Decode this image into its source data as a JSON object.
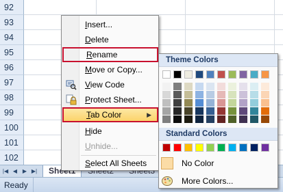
{
  "rows": [
    "92",
    "93",
    "94",
    "95",
    "96",
    "97",
    "98",
    "99",
    "100",
    "101",
    "102"
  ],
  "sheet_tabs": [
    "Sheet1",
    "Sheet2",
    "Sheet3"
  ],
  "status": {
    "text": "Ready"
  },
  "context_menu": {
    "items": [
      {
        "label": "Insert...",
        "underline": "I"
      },
      {
        "label": "Delete",
        "underline": "D"
      },
      {
        "label": "Rename",
        "underline": "R"
      },
      {
        "label": "Move or Copy...",
        "underline": "M"
      },
      {
        "label": "View Code",
        "underline": "V"
      },
      {
        "label": "Protect Sheet...",
        "underline": "P"
      },
      {
        "label": "Tab Color",
        "underline": "T"
      },
      {
        "label": "Hide",
        "underline": "H"
      },
      {
        "label": "Unhide...",
        "underline": "U"
      },
      {
        "label": "Select All Sheets",
        "underline": "S"
      }
    ]
  },
  "tab_color_menu": {
    "theme_colors_label": "Theme Colors",
    "standard_colors_label": "Standard Colors",
    "no_color_label": "No Color",
    "more_colors_label": "More Colors...",
    "theme_base": [
      "#ffffff",
      "#000000",
      "#eeece1",
      "#1f497d",
      "#4f81bd",
      "#c0504d",
      "#9bbb59",
      "#8064a2",
      "#4bacc6",
      "#f79646"
    ],
    "theme_shades": [
      [
        "#f2f2f2",
        "#7f7f7f",
        "#ddd9c3",
        "#c6d9f0",
        "#dbe5f1",
        "#f2dcdb",
        "#ebf1dd",
        "#e5e0ec",
        "#dbeef3",
        "#fdeada"
      ],
      [
        "#d8d8d8",
        "#595959",
        "#c4bd97",
        "#8db3e2",
        "#b8cce4",
        "#e5b9b7",
        "#d7e3bc",
        "#ccc1d9",
        "#b7dde8",
        "#fbd5b5"
      ],
      [
        "#bfbfbf",
        "#3f3f3f",
        "#938953",
        "#548dd4",
        "#95b3d7",
        "#d99694",
        "#c3d69b",
        "#b2a2c7",
        "#92cddc",
        "#fac08f"
      ],
      [
        "#a5a5a5",
        "#262626",
        "#494429",
        "#17365d",
        "#366092",
        "#953734",
        "#76923c",
        "#5f497a",
        "#31859b",
        "#e36c09"
      ],
      [
        "#7f7f7f",
        "#0c0c0c",
        "#1d1b10",
        "#0f243e",
        "#244061",
        "#632423",
        "#4f6128",
        "#3f3151",
        "#205867",
        "#974806"
      ]
    ],
    "standard": [
      "#c00000",
      "#ff0000",
      "#ffc000",
      "#ffff00",
      "#92d050",
      "#00b050",
      "#00b0f0",
      "#0070c0",
      "#002060",
      "#7030a0"
    ]
  }
}
